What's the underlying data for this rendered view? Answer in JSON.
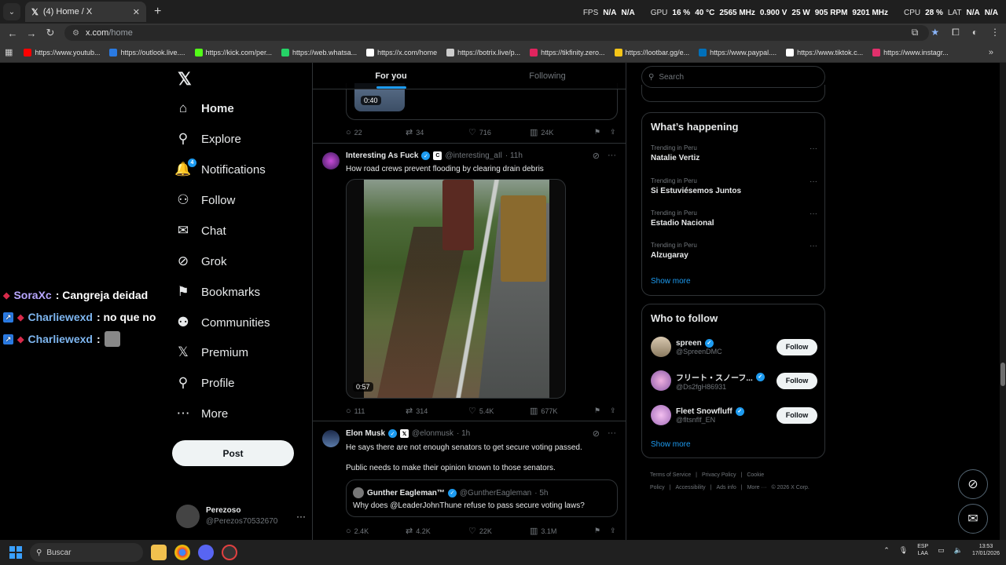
{
  "browser": {
    "tab_title": "(4) Home / X",
    "url_host": "x.com",
    "url_path": "/home",
    "bookmarks": [
      {
        "label": "https://www.youtub...",
        "color": "#ff0000"
      },
      {
        "label": "https://outlook.live....",
        "color": "#2a7ae2"
      },
      {
        "label": "https://kick.com/per...",
        "color": "#53fc18"
      },
      {
        "label": "https://web.whatsa...",
        "color": "#25d366"
      },
      {
        "label": "https://x.com/home",
        "color": "#ffffff"
      },
      {
        "label": "https://botrix.live/p...",
        "color": "#cccccc"
      },
      {
        "label": "https://tikfinity.zero...",
        "color": "#e0245e"
      },
      {
        "label": "https://lootbar.gg/e...",
        "color": "#f5c518"
      },
      {
        "label": "https://www.paypal....",
        "color": "#0070ba"
      },
      {
        "label": "https://www.tiktok.c...",
        "color": "#ffffff"
      },
      {
        "label": "https://www.instagr...",
        "color": "#e1306c"
      }
    ]
  },
  "overlay_stats": {
    "fps_label": "FPS",
    "fps1": "N/A",
    "fps2": "N/A",
    "gpu_label": "GPU",
    "gpu_pct": "16 %",
    "gpu_temp": "40 °C",
    "gpu_clock": "2565 MHz",
    "gpu_volt": "0.900 V",
    "gpu_watt": "25 W",
    "gpu_rpm": "905 RPM",
    "gpu_mem": "9201 MHz",
    "cpu_label": "CPU",
    "cpu_pct": "28 %",
    "lat_label": "LAT",
    "lat1": "N/A",
    "lat2": "N/A"
  },
  "chat": [
    {
      "user": "SoraXc",
      "message": ": Cangreja deidad"
    },
    {
      "user": "Charliewexd",
      "message": ": no que no"
    },
    {
      "user": "Charliewexd",
      "message": ":"
    }
  ],
  "nav": {
    "items": [
      {
        "label": "Home",
        "icon": "⌂"
      },
      {
        "label": "Explore",
        "icon": "⚲"
      },
      {
        "label": "Notifications",
        "icon": "🔔"
      },
      {
        "label": "Follow",
        "icon": "⚇"
      },
      {
        "label": "Chat",
        "icon": "✉"
      },
      {
        "label": "Grok",
        "icon": "⊘"
      },
      {
        "label": "Bookmarks",
        "icon": "⚑"
      },
      {
        "label": "Communities",
        "icon": "⚉"
      },
      {
        "label": "Premium",
        "icon": "𝕏"
      },
      {
        "label": "Profile",
        "icon": "⚲"
      },
      {
        "label": "More",
        "icon": "⋯"
      }
    ],
    "notif_count": "4",
    "post_label": "Post",
    "account_name": "Perezoso",
    "account_handle": "@Perezos70532670"
  },
  "timeline": {
    "tabs": [
      "For you",
      "Following"
    ],
    "prev_duration": "0:40",
    "prev_actions": {
      "replies": "22",
      "reposts": "34",
      "likes": "716",
      "views": "24K"
    },
    "tweet1": {
      "name": "Interesting As Fuck",
      "handle": "@interesting_aIl",
      "time": "· 11h",
      "text": "How road crews prevent flooding by clearing drain debris",
      "duration": "0:57",
      "replies": "111",
      "reposts": "314",
      "likes": "5.4K",
      "views": "677K"
    },
    "tweet2": {
      "name": "Elon Musk",
      "handle": "@elonmusk",
      "time": "· 1h",
      "text1": "He says there are not enough senators to get secure voting passed.",
      "text2": "Public needs to make their opinion known to those senators.",
      "quote_name": "Gunther Eagleman™",
      "quote_handle": "@GuntherEagleman",
      "quote_time": "· 5h",
      "quote_text": "Why does @LeaderJohnThune refuse to pass secure voting laws?",
      "replies": "2.4K",
      "reposts": "4.2K",
      "likes": "22K",
      "views": "3.1M"
    }
  },
  "right": {
    "search_placeholder": "Search",
    "happening_title": "What’s happening",
    "trends": [
      {
        "context": "Trending in Peru",
        "title": "Natalie Vertiz"
      },
      {
        "context": "Trending in Peru",
        "title": "Si Estuviésemos Juntos"
      },
      {
        "context": "Trending in Peru",
        "title": "Estadio Nacional"
      },
      {
        "context": "Trending in Peru",
        "title": "Alzugaray"
      }
    ],
    "show_more": "Show more",
    "wtf_title": "Who to follow",
    "suggestions": [
      {
        "name": "spreen",
        "handle": "@SpreenDMC",
        "follow": "Follow"
      },
      {
        "name": "フリート・スノーフ...",
        "handle": "@Ds2fgH86931",
        "follow": "Follow"
      },
      {
        "name": "Fleet Snowfluff",
        "handle": "@fltsnflf_EN",
        "follow": "Follow"
      }
    ],
    "footer": [
      "Terms of Service",
      "|",
      "Privacy Policy",
      "|",
      "Cookie Policy",
      "|",
      "Accessibility",
      "|",
      "Ads info",
      "|",
      "More ···",
      "© 2026 X Corp."
    ]
  },
  "taskbar": {
    "search_label": "Buscar",
    "lang1": "ESP",
    "lang2": "LAA",
    "time": "13:53",
    "date": "17/01/2026"
  }
}
